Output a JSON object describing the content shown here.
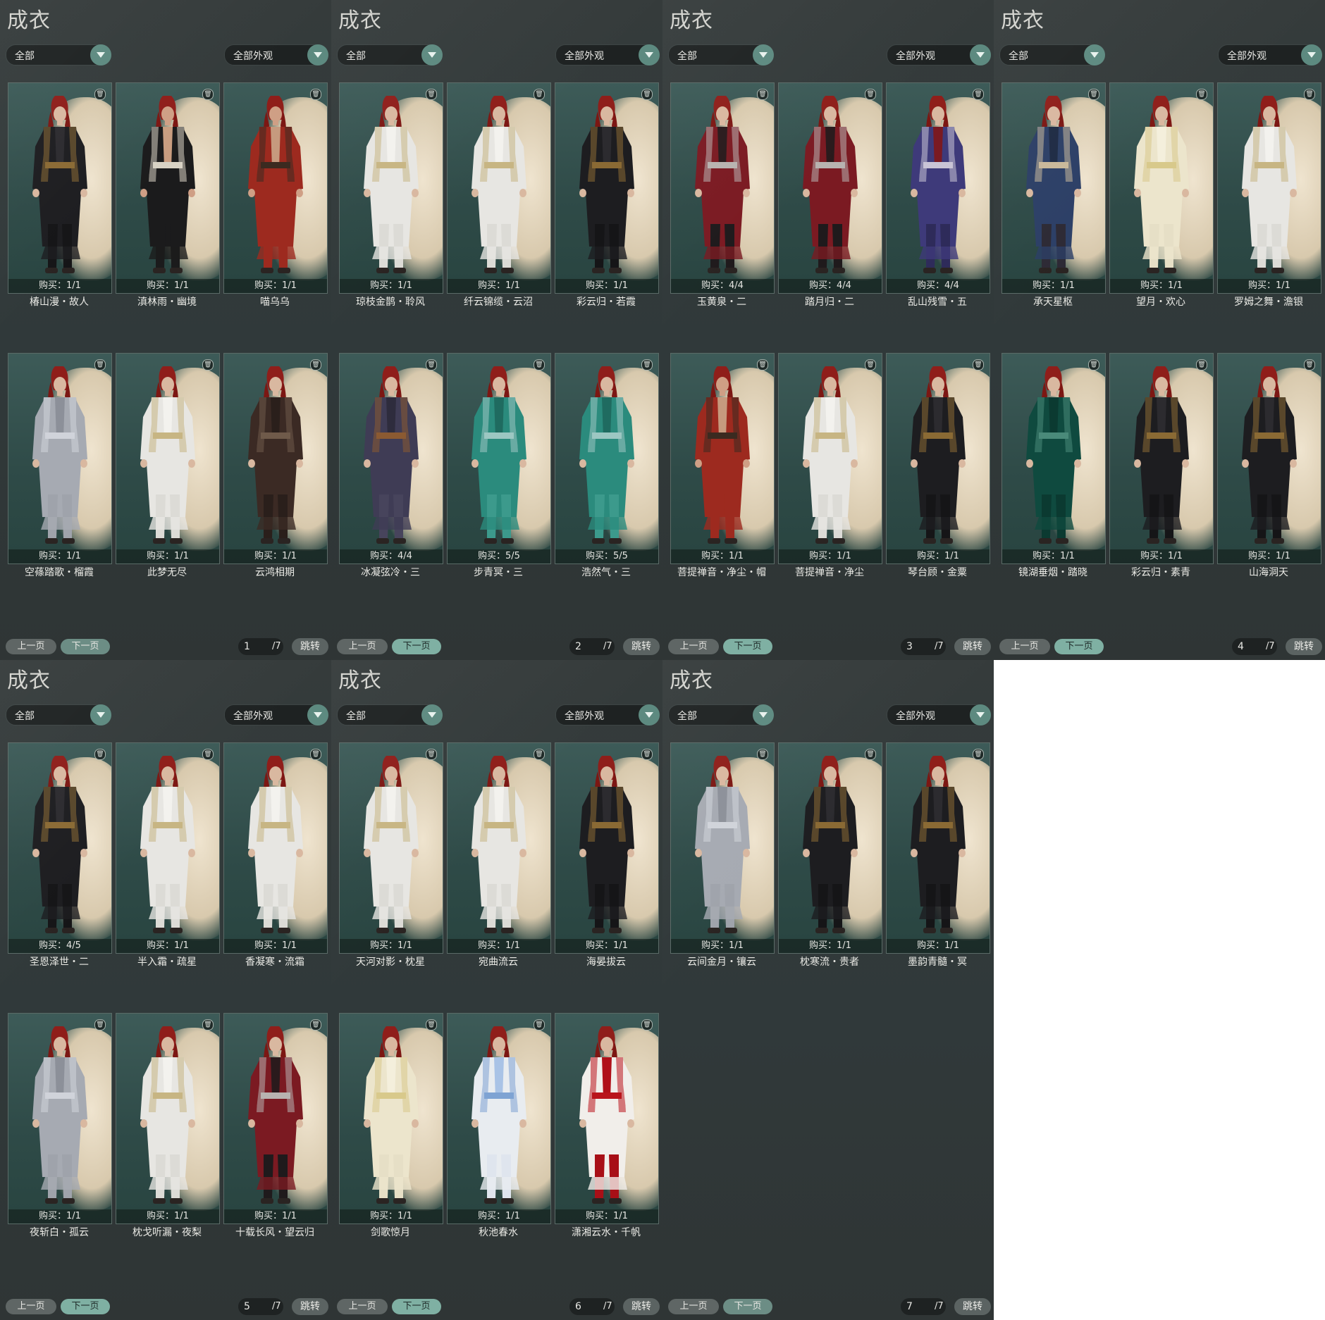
{
  "panels": [
    {
      "title": "成衣",
      "filter_left": "全部",
      "filter_right": "全部外观",
      "page": "1",
      "total": "/7",
      "prev": "上一页",
      "next": "下一页",
      "jump": "跳转",
      "items": [
        {
          "name": "椿山漫・故人",
          "buy": "购买：1/1",
          "palette": "dark"
        },
        {
          "name": "滇林雨・幽境",
          "buy": "购买：1/1",
          "palette": "shirtless"
        },
        {
          "name": "喵乌乌",
          "buy": "购买：1/1",
          "palette": "red"
        },
        {
          "name": "空蓧踏歌・榴霞",
          "buy": "购买：1/1",
          "palette": "silver"
        },
        {
          "name": "此梦无尽",
          "buy": "购买：1/1",
          "palette": "white"
        },
        {
          "name": "云鸿相期",
          "buy": "购买：1/1",
          "palette": "brown"
        }
      ]
    },
    {
      "title": "成衣",
      "filter_left": "全部",
      "filter_right": "全部外观",
      "page": "2",
      "total": "/7",
      "prev": "上一页",
      "next": "下一页",
      "jump": "跳转",
      "items": [
        {
          "name": "琼枝金鹊・聆风",
          "buy": "购买：1/1",
          "palette": "white"
        },
        {
          "name": "纤云锦缆・云沼",
          "buy": "购买：1/1",
          "palette": "white"
        },
        {
          "name": "彩云归・若霞",
          "buy": "购买：1/1",
          "palette": "dark"
        },
        {
          "name": "冰凝弦冷・三",
          "buy": "购买：4/4",
          "palette": "navy"
        },
        {
          "name": "步青冥・三",
          "buy": "购买：5/5",
          "palette": "teal"
        },
        {
          "name": "浩然气・三",
          "buy": "购买：5/5",
          "palette": "teal"
        }
      ]
    },
    {
      "title": "成衣",
      "filter_left": "全部",
      "filter_right": "全部外观",
      "page": "3",
      "total": "/7",
      "prev": "上一页",
      "next": "下一页",
      "jump": "跳转",
      "items": [
        {
          "name": "玉黄泉・二",
          "buy": "购买：4/4",
          "palette": "crimson"
        },
        {
          "name": "踏月归・二",
          "buy": "购买：4/4",
          "palette": "crimson"
        },
        {
          "name": "乱山残雪・五",
          "buy": "购买：4/4",
          "palette": "purple"
        },
        {
          "name": "菩提禅音・净尘・帽",
          "buy": "购买：1/1",
          "palette": "red"
        },
        {
          "name": "菩提禅音・净尘",
          "buy": "购买：1/1",
          "palette": "white"
        },
        {
          "name": "琴台顾・金粟",
          "buy": "购买：1/1",
          "palette": "dark"
        }
      ]
    },
    {
      "title": "成衣",
      "filter_left": "全部",
      "filter_right": "全部外观",
      "page": "4",
      "total": "/7",
      "prev": "上一页",
      "next": "下一页",
      "jump": "跳转",
      "items": [
        {
          "name": "承天星枢",
          "buy": "购买：1/1",
          "palette": "blue"
        },
        {
          "name": "望月・欢心",
          "buy": "购买：1/1",
          "palette": "cream"
        },
        {
          "name": "罗姆之舞・澹银",
          "buy": "购买：1/1",
          "palette": "white"
        },
        {
          "name": "镜湖垂烟・踏晓",
          "buy": "购买：1/1",
          "palette": "green"
        },
        {
          "name": "彩云归・素青",
          "buy": "购买：1/1",
          "palette": "dark"
        },
        {
          "name": "山海洞天",
          "buy": "购买：1/1",
          "palette": "dark"
        }
      ]
    },
    {
      "title": "成衣",
      "filter_left": "全部",
      "filter_right": "全部外观",
      "page": "5",
      "total": "/7",
      "prev": "上一页",
      "next": "下一页",
      "jump": "跳转",
      "items": [
        {
          "name": "圣恩泽世・二",
          "buy": "购买：4/5",
          "palette": "dark"
        },
        {
          "name": "半入霜・疏星",
          "buy": "购买：1/1",
          "palette": "white"
        },
        {
          "name": "香凝寒・流霜",
          "buy": "购买：1/1",
          "palette": "white"
        },
        {
          "name": "夜斩白・孤云",
          "buy": "购买：1/1",
          "palette": "silver"
        },
        {
          "name": "枕戈听漏・夜梨",
          "buy": "购买：1/1",
          "palette": "white"
        },
        {
          "name": "十载长风・望云归",
          "buy": "购买：1/1",
          "palette": "crimson"
        }
      ]
    },
    {
      "title": "成衣",
      "filter_left": "全部",
      "filter_right": "全部外观",
      "page": "6",
      "total": "/7",
      "prev": "上一页",
      "next": "下一页",
      "jump": "跳转",
      "items": [
        {
          "name": "天河对影・枕星",
          "buy": "购买：1/1",
          "palette": "white"
        },
        {
          "name": "宛曲流云",
          "buy": "购买：1/1",
          "palette": "white"
        },
        {
          "name": "海晏拔云",
          "buy": "购买：1/1",
          "palette": "dark"
        },
        {
          "name": "剑歌惊月",
          "buy": "购买：1/1",
          "palette": "cream"
        },
        {
          "name": "秋池春水",
          "buy": "购买：1/1",
          "palette": "lightblue"
        },
        {
          "name": "潇湘云水・千帆",
          "buy": "购买：1/1",
          "palette": "redwhite"
        }
      ]
    },
    {
      "title": "成衣",
      "filter_left": "全部",
      "filter_right": "全部外观",
      "page": "7",
      "total": "/7",
      "prev": "上一页",
      "next": "下一页",
      "jump": "跳转",
      "items": [
        {
          "name": "云间金月・镶云",
          "buy": "购买：1/1",
          "palette": "silver"
        },
        {
          "name": "枕寒流・贵者",
          "buy": "购买：1/1",
          "palette": "dark"
        },
        {
          "name": "墨韵青髓・冥",
          "buy": "购买：1/1",
          "palette": "dark"
        }
      ]
    }
  ]
}
